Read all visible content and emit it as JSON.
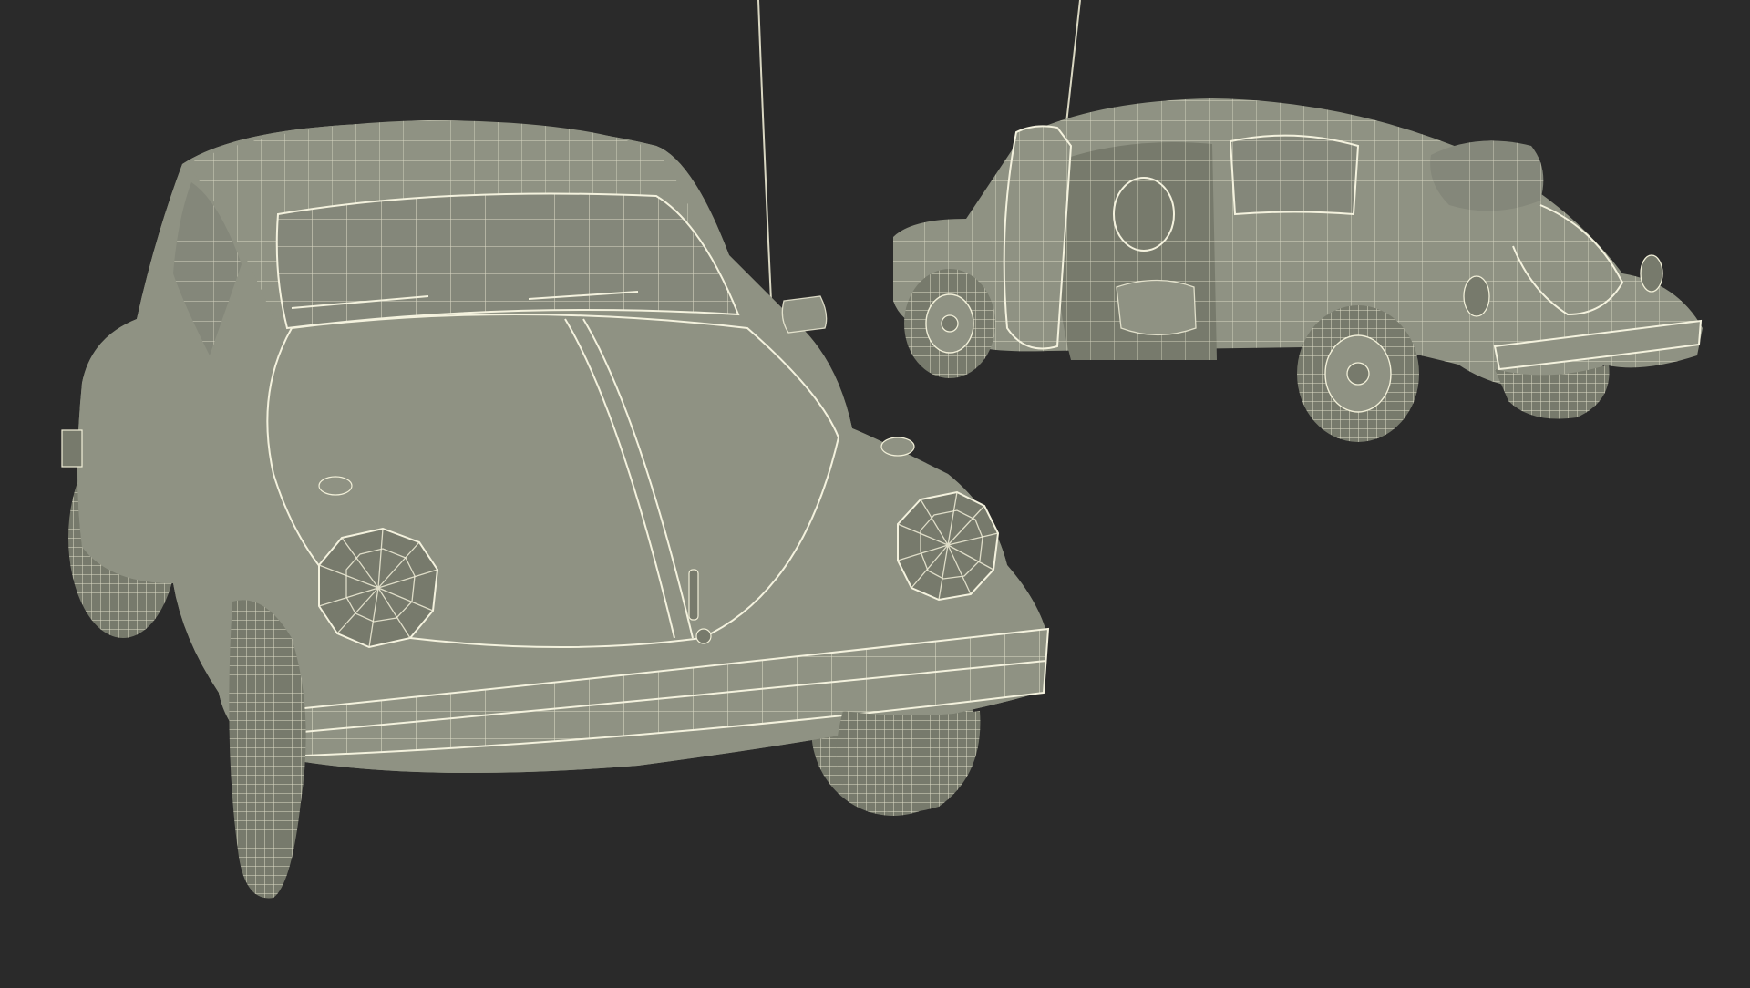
{
  "scene": {
    "background": "#2a2a2a",
    "mesh_body_color": "#8f9283",
    "wireframe_color": "#f1efd8",
    "views": [
      {
        "id": "front-view"
      },
      {
        "id": "rear-three-quarter-view"
      }
    ]
  }
}
